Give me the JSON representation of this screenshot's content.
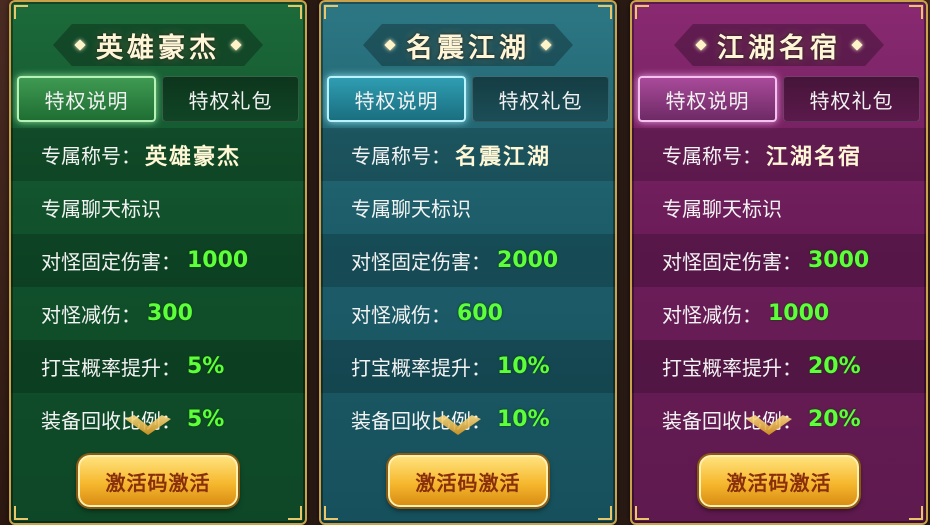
{
  "panels": [
    {
      "title": "英雄豪杰",
      "theme": "green",
      "tabs": [
        "特权说明",
        "特权礼包"
      ],
      "title_label": "专属称号：",
      "title_value": "英雄豪杰",
      "chat_badge": "专属聊天标识",
      "stats": [
        {
          "label": "对怪固定伤害：",
          "value": "1000"
        },
        {
          "label": "对怪减伤：",
          "value": "300"
        },
        {
          "label": "打宝概率提升：",
          "value": "5%"
        },
        {
          "label": "装备回收比例：",
          "value": "5%"
        }
      ],
      "button": "激活码激活"
    },
    {
      "title": "名震江湖",
      "theme": "teal",
      "tabs": [
        "特权说明",
        "特权礼包"
      ],
      "title_label": "专属称号：",
      "title_value": "名震江湖",
      "chat_badge": "专属聊天标识",
      "stats": [
        {
          "label": "对怪固定伤害：",
          "value": "2000"
        },
        {
          "label": "对怪减伤：",
          "value": "600"
        },
        {
          "label": "打宝概率提升：",
          "value": "10%"
        },
        {
          "label": "装备回收比例：",
          "value": "10%"
        }
      ],
      "button": "激活码激活"
    },
    {
      "title": "江湖名宿",
      "theme": "purple",
      "tabs": [
        "特权说明",
        "特权礼包"
      ],
      "title_label": "专属称号：",
      "title_value": "江湖名宿",
      "chat_badge": "专属聊天标识",
      "stats": [
        {
          "label": "对怪固定伤害：",
          "value": "3000"
        },
        {
          "label": "对怪减伤：",
          "value": "1000"
        },
        {
          "label": "打宝概率提升：",
          "value": "20%"
        },
        {
          "label": "装备回收比例：",
          "value": "20%"
        }
      ],
      "button": "激活码激活"
    }
  ],
  "colors": {
    "green_panel": "#11522c",
    "teal_panel": "#1d5e6a",
    "purple_panel": "#6d1d5a",
    "stat_value": "#5cff3a",
    "gold_border": "#c9a24a",
    "button_gold": "#f6b82e"
  }
}
